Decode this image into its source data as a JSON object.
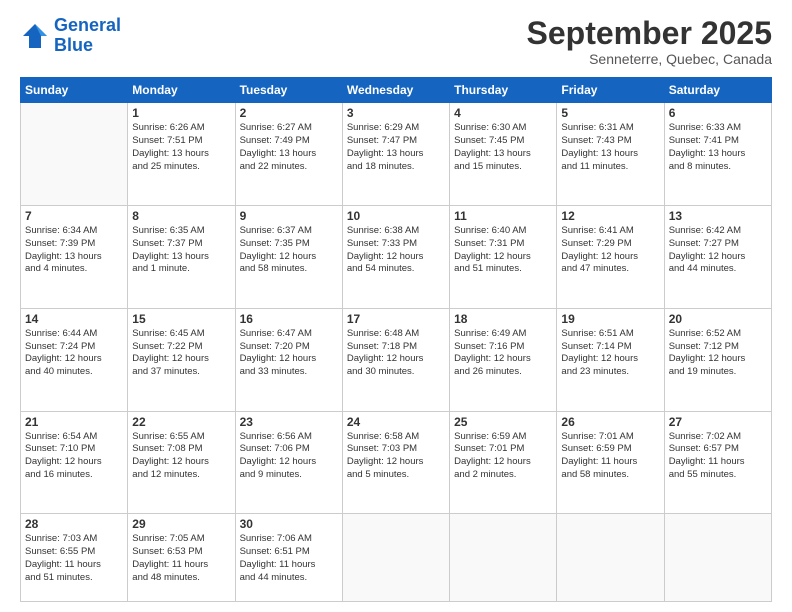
{
  "header": {
    "logo_line1": "General",
    "logo_line2": "Blue",
    "month": "September 2025",
    "location": "Senneterre, Quebec, Canada"
  },
  "weekdays": [
    "Sunday",
    "Monday",
    "Tuesday",
    "Wednesday",
    "Thursday",
    "Friday",
    "Saturday"
  ],
  "weeks": [
    [
      {
        "day": "",
        "text": ""
      },
      {
        "day": "1",
        "text": "Sunrise: 6:26 AM\nSunset: 7:51 PM\nDaylight: 13 hours\nand 25 minutes."
      },
      {
        "day": "2",
        "text": "Sunrise: 6:27 AM\nSunset: 7:49 PM\nDaylight: 13 hours\nand 22 minutes."
      },
      {
        "day": "3",
        "text": "Sunrise: 6:29 AM\nSunset: 7:47 PM\nDaylight: 13 hours\nand 18 minutes."
      },
      {
        "day": "4",
        "text": "Sunrise: 6:30 AM\nSunset: 7:45 PM\nDaylight: 13 hours\nand 15 minutes."
      },
      {
        "day": "5",
        "text": "Sunrise: 6:31 AM\nSunset: 7:43 PM\nDaylight: 13 hours\nand 11 minutes."
      },
      {
        "day": "6",
        "text": "Sunrise: 6:33 AM\nSunset: 7:41 PM\nDaylight: 13 hours\nand 8 minutes."
      }
    ],
    [
      {
        "day": "7",
        "text": "Sunrise: 6:34 AM\nSunset: 7:39 PM\nDaylight: 13 hours\nand 4 minutes."
      },
      {
        "day": "8",
        "text": "Sunrise: 6:35 AM\nSunset: 7:37 PM\nDaylight: 13 hours\nand 1 minute."
      },
      {
        "day": "9",
        "text": "Sunrise: 6:37 AM\nSunset: 7:35 PM\nDaylight: 12 hours\nand 58 minutes."
      },
      {
        "day": "10",
        "text": "Sunrise: 6:38 AM\nSunset: 7:33 PM\nDaylight: 12 hours\nand 54 minutes."
      },
      {
        "day": "11",
        "text": "Sunrise: 6:40 AM\nSunset: 7:31 PM\nDaylight: 12 hours\nand 51 minutes."
      },
      {
        "day": "12",
        "text": "Sunrise: 6:41 AM\nSunset: 7:29 PM\nDaylight: 12 hours\nand 47 minutes."
      },
      {
        "day": "13",
        "text": "Sunrise: 6:42 AM\nSunset: 7:27 PM\nDaylight: 12 hours\nand 44 minutes."
      }
    ],
    [
      {
        "day": "14",
        "text": "Sunrise: 6:44 AM\nSunset: 7:24 PM\nDaylight: 12 hours\nand 40 minutes."
      },
      {
        "day": "15",
        "text": "Sunrise: 6:45 AM\nSunset: 7:22 PM\nDaylight: 12 hours\nand 37 minutes."
      },
      {
        "day": "16",
        "text": "Sunrise: 6:47 AM\nSunset: 7:20 PM\nDaylight: 12 hours\nand 33 minutes."
      },
      {
        "day": "17",
        "text": "Sunrise: 6:48 AM\nSunset: 7:18 PM\nDaylight: 12 hours\nand 30 minutes."
      },
      {
        "day": "18",
        "text": "Sunrise: 6:49 AM\nSunset: 7:16 PM\nDaylight: 12 hours\nand 26 minutes."
      },
      {
        "day": "19",
        "text": "Sunrise: 6:51 AM\nSunset: 7:14 PM\nDaylight: 12 hours\nand 23 minutes."
      },
      {
        "day": "20",
        "text": "Sunrise: 6:52 AM\nSunset: 7:12 PM\nDaylight: 12 hours\nand 19 minutes."
      }
    ],
    [
      {
        "day": "21",
        "text": "Sunrise: 6:54 AM\nSunset: 7:10 PM\nDaylight: 12 hours\nand 16 minutes."
      },
      {
        "day": "22",
        "text": "Sunrise: 6:55 AM\nSunset: 7:08 PM\nDaylight: 12 hours\nand 12 minutes."
      },
      {
        "day": "23",
        "text": "Sunrise: 6:56 AM\nSunset: 7:06 PM\nDaylight: 12 hours\nand 9 minutes."
      },
      {
        "day": "24",
        "text": "Sunrise: 6:58 AM\nSunset: 7:03 PM\nDaylight: 12 hours\nand 5 minutes."
      },
      {
        "day": "25",
        "text": "Sunrise: 6:59 AM\nSunset: 7:01 PM\nDaylight: 12 hours\nand 2 minutes."
      },
      {
        "day": "26",
        "text": "Sunrise: 7:01 AM\nSunset: 6:59 PM\nDaylight: 11 hours\nand 58 minutes."
      },
      {
        "day": "27",
        "text": "Sunrise: 7:02 AM\nSunset: 6:57 PM\nDaylight: 11 hours\nand 55 minutes."
      }
    ],
    [
      {
        "day": "28",
        "text": "Sunrise: 7:03 AM\nSunset: 6:55 PM\nDaylight: 11 hours\nand 51 minutes."
      },
      {
        "day": "29",
        "text": "Sunrise: 7:05 AM\nSunset: 6:53 PM\nDaylight: 11 hours\nand 48 minutes."
      },
      {
        "day": "30",
        "text": "Sunrise: 7:06 AM\nSunset: 6:51 PM\nDaylight: 11 hours\nand 44 minutes."
      },
      {
        "day": "",
        "text": ""
      },
      {
        "day": "",
        "text": ""
      },
      {
        "day": "",
        "text": ""
      },
      {
        "day": "",
        "text": ""
      }
    ]
  ]
}
